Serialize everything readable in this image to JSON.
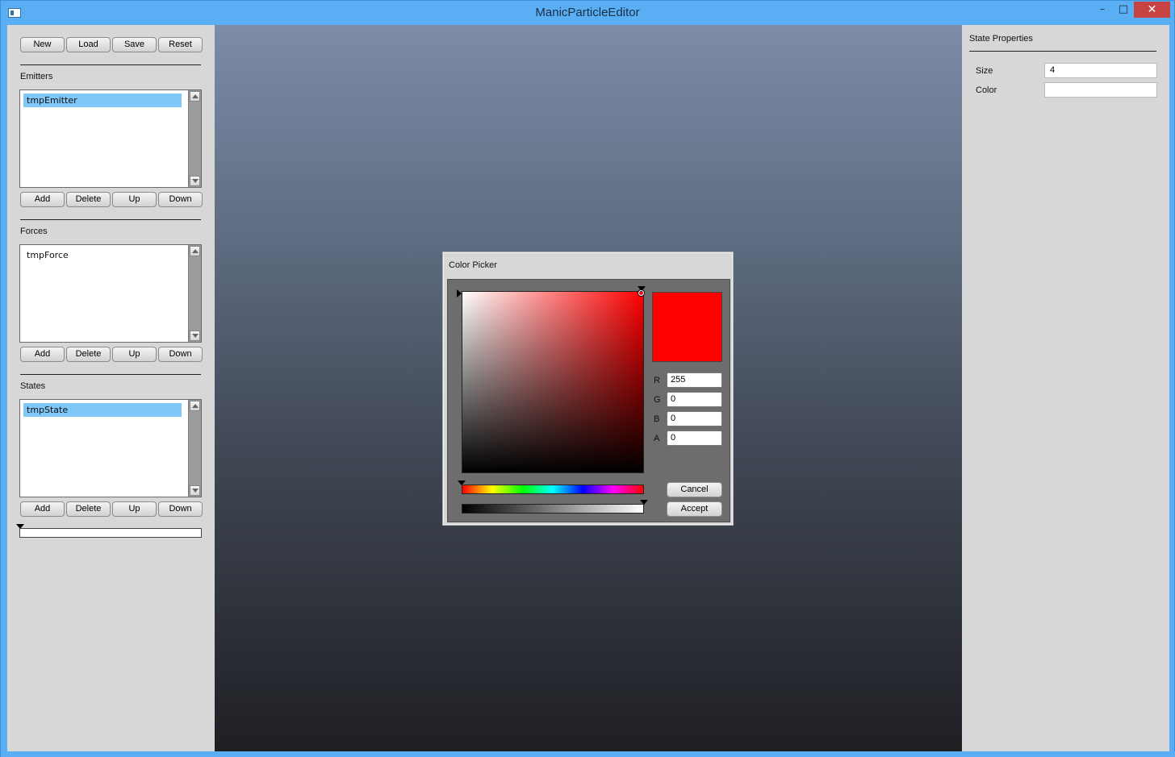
{
  "window": {
    "title": "ManicParticleEditor",
    "minimize_glyph": "–",
    "maximize_glyph": "□",
    "close_glyph": "✕"
  },
  "toolbar": {
    "new_label": "New",
    "load_label": "Load",
    "save_label": "Save",
    "reset_label": "Reset"
  },
  "emitters": {
    "label": "Emitters",
    "items": [
      "tmpEmitter"
    ],
    "selected_index": 0,
    "add_label": "Add",
    "delete_label": "Delete",
    "up_label": "Up",
    "down_label": "Down"
  },
  "forces": {
    "label": "Forces",
    "items": [
      "tmpForce"
    ],
    "add_label": "Add",
    "delete_label": "Delete",
    "up_label": "Up",
    "down_label": "Down"
  },
  "states": {
    "label": "States",
    "items": [
      "tmpState"
    ],
    "selected_index": 0,
    "add_label": "Add",
    "delete_label": "Delete",
    "up_label": "Up",
    "down_label": "Down"
  },
  "bottom_slider": {
    "value": 0
  },
  "color_picker": {
    "title": "Color Picker",
    "preview_color": "#ff0000",
    "r_label": "R",
    "g_label": "G",
    "b_label": "B",
    "a_label": "A",
    "r_value": "255",
    "g_value": "0",
    "b_value": "0",
    "a_value": "0",
    "hue_value": 0,
    "alpha_value": 1,
    "cancel_label": "Cancel",
    "accept_label": "Accept"
  },
  "state_properties": {
    "title": "State Properties",
    "size_label": "Size",
    "size_value": "4",
    "color_label": "Color",
    "color_value": ""
  },
  "colors": {
    "titlebar": "#5aaef3",
    "panel": "#d7d7d7",
    "selection": "#7fc7f9",
    "close_button": "#c74242"
  }
}
